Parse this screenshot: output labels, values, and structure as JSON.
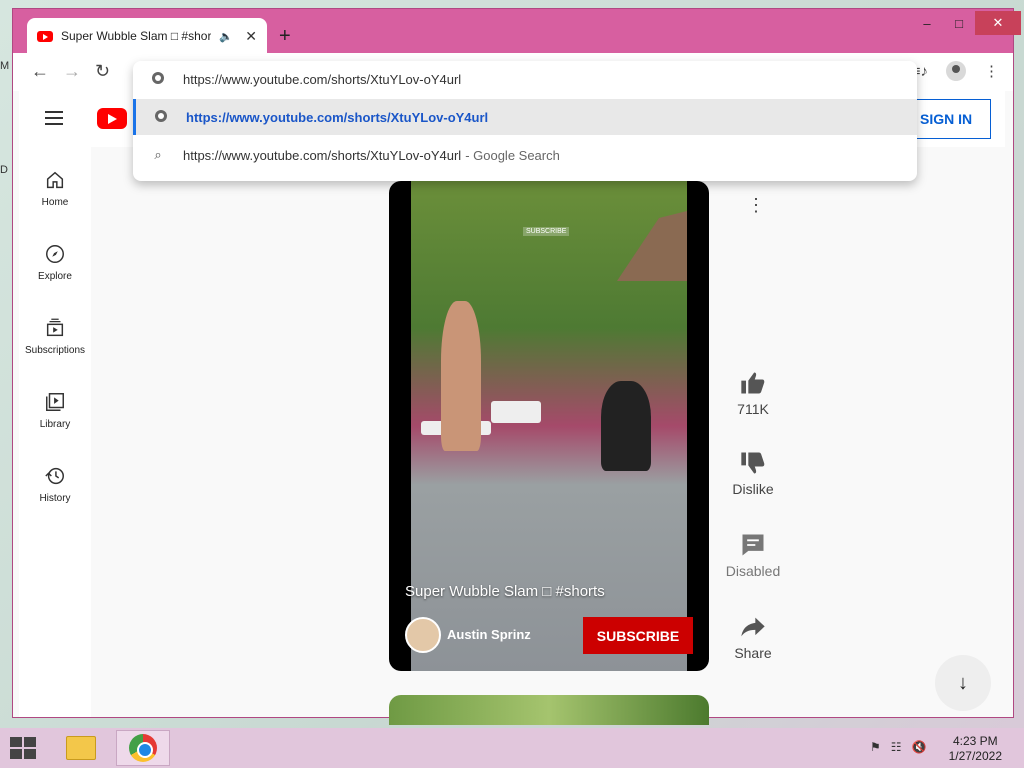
{
  "browser": {
    "tab_title": "Super Wubble Slam □ #shorts",
    "tab_audio": "🔈",
    "tab_close": "✕",
    "new_tab": "+",
    "window_controls": {
      "minimize": "–",
      "maximize": "□",
      "close": "✕"
    },
    "nav": {
      "back": "←",
      "forward": "→",
      "reload": "↻"
    },
    "toolbar_right": {
      "media": "≡♪",
      "menu": "⋮"
    },
    "omnibox": {
      "input_value": "https://www.youtube.com/shorts/XtuYLov-oY4url",
      "suggestion_url": "https://www.youtube.com/shorts/XtuYLov-oY4url",
      "suggestion_search": "https://www.youtube.com/shorts/XtuYLov-oY4url",
      "search_suffix": "- Google Search",
      "search_icon": "⌕"
    }
  },
  "youtube": {
    "sign_in": "SIGN IN",
    "sidebar": [
      {
        "label": "Home",
        "icon": "home-icon"
      },
      {
        "label": "Explore",
        "icon": "compass-icon"
      },
      {
        "label": "Subscriptions",
        "icon": "subscriptions-icon"
      },
      {
        "label": "Library",
        "icon": "library-icon"
      },
      {
        "label": "History",
        "icon": "history-icon"
      }
    ],
    "short": {
      "title": "Super Wubble Slam □ #shorts",
      "channel": "Austin Sprinz",
      "subscribe": "SUBSCRIBE",
      "watermark": "SUBSCRIBE"
    },
    "actions": {
      "more": "⋮",
      "like_count": "711K",
      "dislike": "Dislike",
      "comments": "Disabled",
      "share": "Share"
    },
    "scroll_down": "↓"
  },
  "taskbar": {
    "time": "4:23 PM",
    "date": "1/27/2022",
    "tray": {
      "flag": "⚑",
      "network": "☷",
      "volume": "🔇"
    }
  },
  "desktop": {
    "glyph_top": "M",
    "glyph_mid": "D"
  },
  "colors": {
    "window_frame": "#d75fa0",
    "youtube_red": "#ff0000",
    "subscribe_red": "#cc0000",
    "link_blue": "#065fd4"
  }
}
